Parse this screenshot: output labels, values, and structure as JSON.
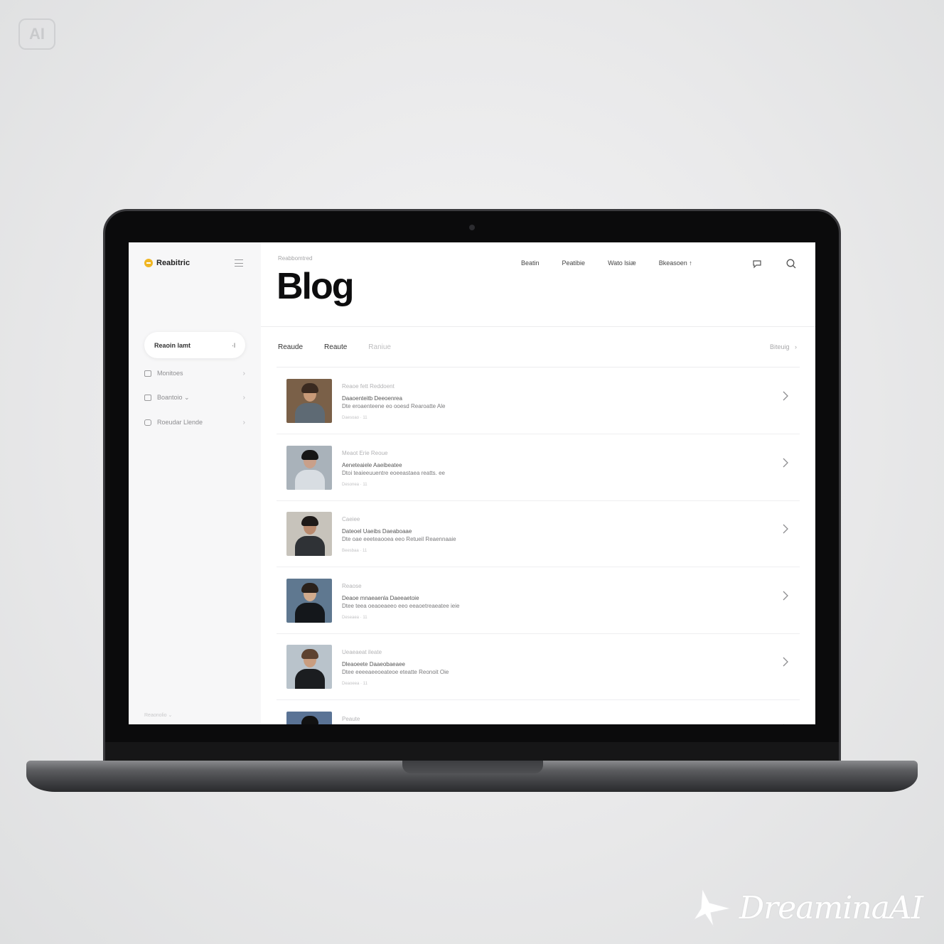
{
  "badge": "AI",
  "watermark": "DreaminaAI",
  "sidebar": {
    "brand": "Reabitric",
    "active_item": {
      "label": "Reaoin lamt",
      "mini": "·l"
    },
    "items": [
      {
        "label": "Monitoes",
        "icon": "calendar-icon"
      },
      {
        "label": "Boantoio ⌄",
        "icon": "list-icon"
      },
      {
        "label": "Roeudar Llende",
        "icon": "box-icon"
      }
    ],
    "footer": "Reaonolio ⌄"
  },
  "header": {
    "breadcrumb": "Reabbomtred",
    "title": "Blog",
    "nav": [
      "Beatin",
      "Peatibie",
      "Wato lsiæ",
      "Bkeasoen ↑"
    ]
  },
  "tabs": [
    "Reaude",
    "Reaute",
    "Raniue"
  ],
  "view_all": "Biteuig",
  "posts": [
    {
      "meta": "Reaoe fett Reddoent",
      "title": "Daaoenteitb Deeoenrea",
      "excerpt": "Dte eroaenteene eo ooesd Rearoatte Ale",
      "date": "Daesoao · 11",
      "photo": {
        "bg": "#7a6048",
        "skin": "#c89a78",
        "hair": "#3a2a20",
        "body": "#5e6a74"
      }
    },
    {
      "meta": "Meaot Erie Reoue",
      "title": "Aeneteaiele Aaeibeatee",
      "excerpt": "Dtoi teaieeuuentre eoeeastaea reatts. ee",
      "date": "Desonea · 11",
      "photo": {
        "bg": "#a9b2ba",
        "skin": "#c9a08a",
        "hair": "#161616",
        "body": "#d8dde2"
      }
    },
    {
      "meta": "Caeiee",
      "title": "Dateoel Uaeibs Daeaboaae",
      "excerpt": "Dte oae eeeteaooea eeo Retueil Reaennaaie",
      "date": "Beesbaa · 11",
      "photo": {
        "bg": "#c7c3bb",
        "skin": "#b98a6e",
        "hair": "#1e1a18",
        "body": "#2f3236"
      }
    },
    {
      "meta": "Reaose",
      "title": "Deaoe mnaeaenla Daeeaetoie",
      "excerpt": "Dtee teea oeaoeaeeo eeo eeaoetreaeatee ieie",
      "date": "Deseaea · 11",
      "photo": {
        "bg": "#5f7890",
        "skin": "#d1ab8d",
        "hair": "#2a211b",
        "body": "#14171b"
      }
    },
    {
      "meta": "Ueaeaeat ileate",
      "title": "Dleaoeete Daaeobaeaee",
      "excerpt": "Dtee eeeeaeeoeateoe eteatte Reonoit Oie",
      "date": "Deaoeea · 11",
      "photo": {
        "bg": "#b9c3cb",
        "skin": "#c99d7f",
        "hair": "#5d4230",
        "body": "#1b1d20"
      }
    },
    {
      "meta": "Peaute",
      "title": "",
      "excerpt": "",
      "date": "",
      "photo": {
        "bg": "#5a7395",
        "skin": "#b78465",
        "hair": "#111111",
        "body": "#222222"
      }
    }
  ]
}
